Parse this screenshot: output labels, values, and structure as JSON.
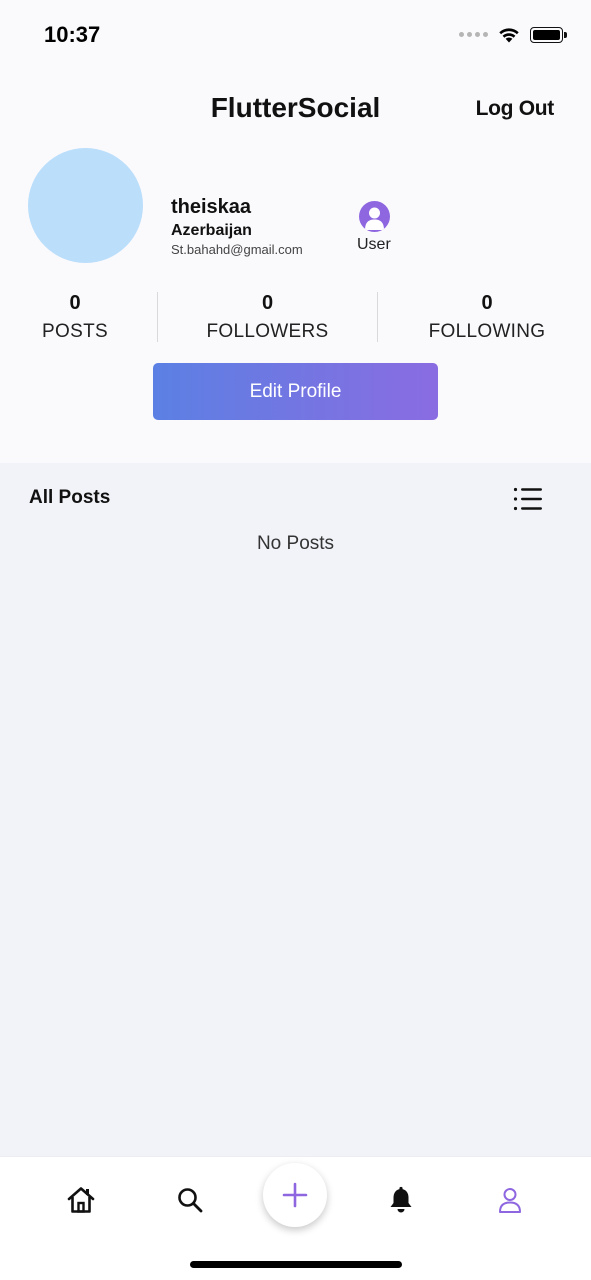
{
  "status_bar": {
    "time": "10:37"
  },
  "header": {
    "title": "FlutterSocial",
    "logout_label": "Log Out"
  },
  "profile": {
    "username": "theiskaa",
    "country": "Azerbaijan",
    "email": "St.bahahd@gmail.com",
    "role": "User",
    "avatar_color": "#bbdefb"
  },
  "stats": [
    {
      "value": "0",
      "label": "POSTS"
    },
    {
      "value": "0",
      "label": "FOLLOWERS"
    },
    {
      "value": "0",
      "label": "FOLLOWING"
    }
  ],
  "edit_profile_label": "Edit Profile",
  "posts_section": {
    "title": "All Posts",
    "empty_text": "No Posts"
  },
  "bottom_nav": {
    "items": [
      "home-icon",
      "search-icon",
      "add-icon",
      "bell-icon",
      "profile-icon"
    ],
    "active": "profile-icon",
    "active_color": "#8e67e0"
  },
  "colors": {
    "accent_start": "#5b80e3",
    "accent_end": "#8a6ce2",
    "background": "#f2f3f8"
  }
}
